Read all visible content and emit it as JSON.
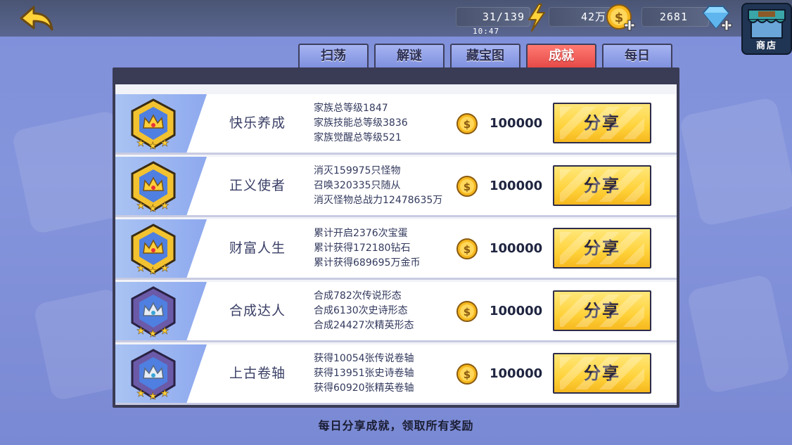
{
  "topbar": {
    "energy": "31/139",
    "time": "10:47",
    "gold": "42万",
    "gems": "2681",
    "shop_label": "商店"
  },
  "tabs": [
    {
      "label": "扫荡",
      "active": false
    },
    {
      "label": "解谜",
      "active": false
    },
    {
      "label": "藏宝图",
      "active": false
    },
    {
      "label": "成就",
      "active": true
    },
    {
      "label": "每日",
      "active": false
    }
  ],
  "rows": [
    {
      "name": "快乐养成",
      "lines": [
        "家族总等级1847",
        "家族技能总等级3836",
        "家族觉醒总等级521"
      ],
      "reward": "100000",
      "button": "分享",
      "badge_tier": "gold"
    },
    {
      "name": "正义使者",
      "lines": [
        "消灭159975只怪物",
        "召唤320335只随从",
        "消灭怪物总战力12478635万"
      ],
      "reward": "100000",
      "button": "分享",
      "badge_tier": "gold"
    },
    {
      "name": "财富人生",
      "lines": [
        "累计开启2376次宝蛋",
        "累计获得172180钻石",
        "累计获得689695万金币"
      ],
      "reward": "100000",
      "button": "分享",
      "badge_tier": "gold"
    },
    {
      "name": "合成达人",
      "lines": [
        "合成782次传说形态",
        "合成6130次史诗形态",
        "合成24427次精英形态"
      ],
      "reward": "100000",
      "button": "分享",
      "badge_tier": "silver"
    },
    {
      "name": "上古卷轴",
      "lines": [
        "获得10054张传说卷轴",
        "获得13951张史诗卷轴",
        "获得60920张精英卷轴"
      ],
      "reward": "100000",
      "button": "分享",
      "badge_tier": "silver"
    }
  ],
  "footer": "每日分享成就，领取所有奖励",
  "colors": {
    "active_tab": "#e64a48",
    "share_button": "#ffd23a",
    "gold_badge": "#f2c230",
    "silver_badge": "#6b5aa8"
  }
}
